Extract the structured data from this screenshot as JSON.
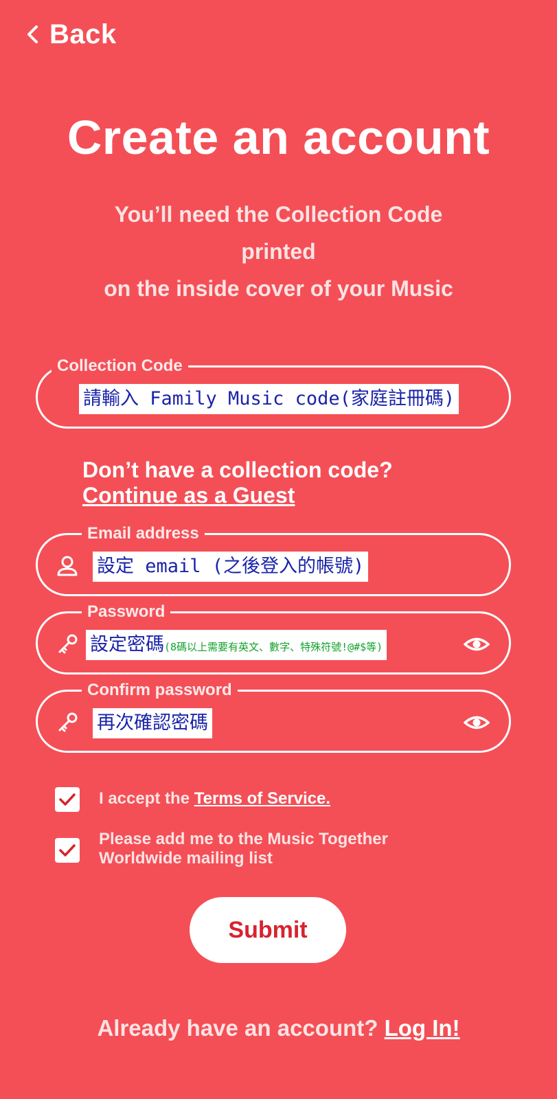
{
  "header": {
    "back_label": "Back"
  },
  "title": "Create an account",
  "subtitle": {
    "line1": "You’ll need the Collection Code",
    "line2": "printed",
    "line3": "on the inside cover of your Music"
  },
  "collection_code": {
    "label": "Collection Code",
    "hint": "請輸入 Family Music code(家庭註冊碼)"
  },
  "guest": {
    "question": "Don’t have a collection code?",
    "link": "Continue as a Guest"
  },
  "email": {
    "label": "Email address",
    "hint": "設定 email (之後登入的帳號)"
  },
  "password": {
    "label": "Password",
    "hint_main": "設定密碼",
    "hint_small": "(8碼以上需要有英文、數字、特殊符號!@#$等)"
  },
  "confirm_password": {
    "label": "Confirm password",
    "hint": "再次確認密碼"
  },
  "terms": {
    "prefix": "I accept the ",
    "link": "Terms of Service.",
    "checked": true
  },
  "mailing": {
    "line1": "Please add me to the Music Together",
    "line2": "Worldwide mailing list",
    "checked": true
  },
  "submit_label": "Submit",
  "footer": {
    "prompt": "Already have an account? ",
    "login": "Log In!"
  },
  "icons": {
    "back": "chevron-left-icon",
    "user": "user-icon",
    "key": "key-icon",
    "eye": "eye-icon",
    "check": "checkmark-icon"
  },
  "colors": {
    "background": "#f44f57",
    "submit_text": "#d7232f",
    "hint_text": "#1a23a8",
    "hint_small_text": "#11a32a"
  }
}
